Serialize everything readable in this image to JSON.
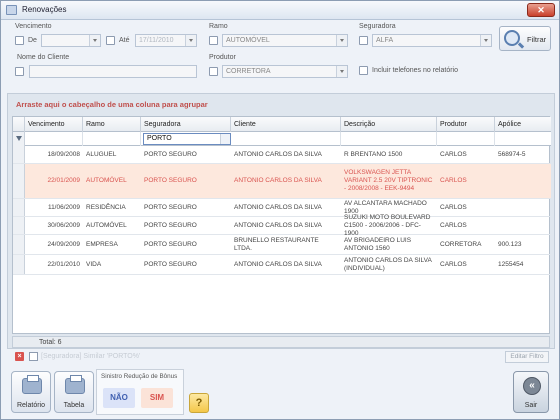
{
  "window": {
    "title": "Renovações"
  },
  "filters": {
    "vencimento_label": "Vencimento",
    "de_label": "De",
    "ate_label": "Até",
    "ate_value": "17/11/2010",
    "ramo_label": "Ramo",
    "ramo_value": "AUTOMÓVEL",
    "seguradora_label": "Seguradora",
    "seguradora_value": "ALFA",
    "nome_cliente_label": "Nome do Cliente",
    "produtor_label": "Produtor",
    "produtor_value": "CORRETORA",
    "incluir_tel_label": "Incluir telefones no relatório",
    "filtrar_label": "Filtrar"
  },
  "grid": {
    "group_hint": "Arraste aqui o cabeçalho de uma coluna para agrupar",
    "columns": [
      "Vencimento",
      "Ramo",
      "Seguradora",
      "Cliente",
      "Descrição",
      "Produtor",
      "Apólice"
    ],
    "filter_value": "PORTO",
    "rows": [
      {
        "venc": "18/09/2008",
        "ramo": "ALUGUEL",
        "seg": "PORTO SEGURO",
        "cli": "ANTONIO CARLOS DA SILVA",
        "desc": "R BRENTANO 1500",
        "prod": "CARLOS",
        "apol": "568974-5"
      },
      {
        "venc": "22/01/2009",
        "ramo": "AUTOMÓVEL",
        "seg": "PORTO SEGURO",
        "cli": "ANTONIO CARLOS DA SILVA",
        "desc": "VOLKSWAGEN JETTA VARIANT 2.5 20V TIPTRONIC - 2008/2008 - EEK-9494",
        "prod": "CARLOS",
        "apol": ""
      },
      {
        "venc": "11/06/2009",
        "ramo": "RESIDÊNCIA",
        "seg": "PORTO SEGURO",
        "cli": "ANTONIO CARLOS DA SILVA",
        "desc": "AV ALCANTARA MACHADO 1900",
        "prod": "CARLOS",
        "apol": ""
      },
      {
        "venc": "30/06/2009",
        "ramo": "AUTOMÓVEL",
        "seg": "PORTO SEGURO",
        "cli": "ANTONIO CARLOS DA SILVA",
        "desc": "SUZUKI MOTO BOULEVARD C1500 - 2006/2006 - DFC-1900",
        "prod": "CARLOS",
        "apol": ""
      },
      {
        "venc": "24/09/2009",
        "ramo": "EMPRESA",
        "seg": "PORTO SEGURO",
        "cli": "BRUNELLO RESTAURANTE LTDA.",
        "desc": "AV BRIGADEIRO LUIS ANTONIO 1560",
        "prod": "CORRETORA",
        "apol": "900.123"
      },
      {
        "venc": "22/01/2010",
        "ramo": "VIDA",
        "seg": "PORTO SEGURO",
        "cli": "ANTONIO CARLOS DA SILVA",
        "desc": "ANTONIO CARLOS DA SILVA (INDIVIDUAL)",
        "prod": "CARLOS",
        "apol": "1255454"
      }
    ],
    "total": "Total: 6"
  },
  "filterbar": {
    "text": "[Seguradora] Similar 'PORTO%'",
    "edit_label": "Editar Filtro"
  },
  "bottom": {
    "relatorio_label": "Relatório",
    "tabela_label": "Tabela",
    "sinistro_caption": "Sinistro Redução de Bônus",
    "nao_label": "NÃO",
    "sim_label": "SIM",
    "help_label": "?",
    "sair_label": "Sair"
  }
}
